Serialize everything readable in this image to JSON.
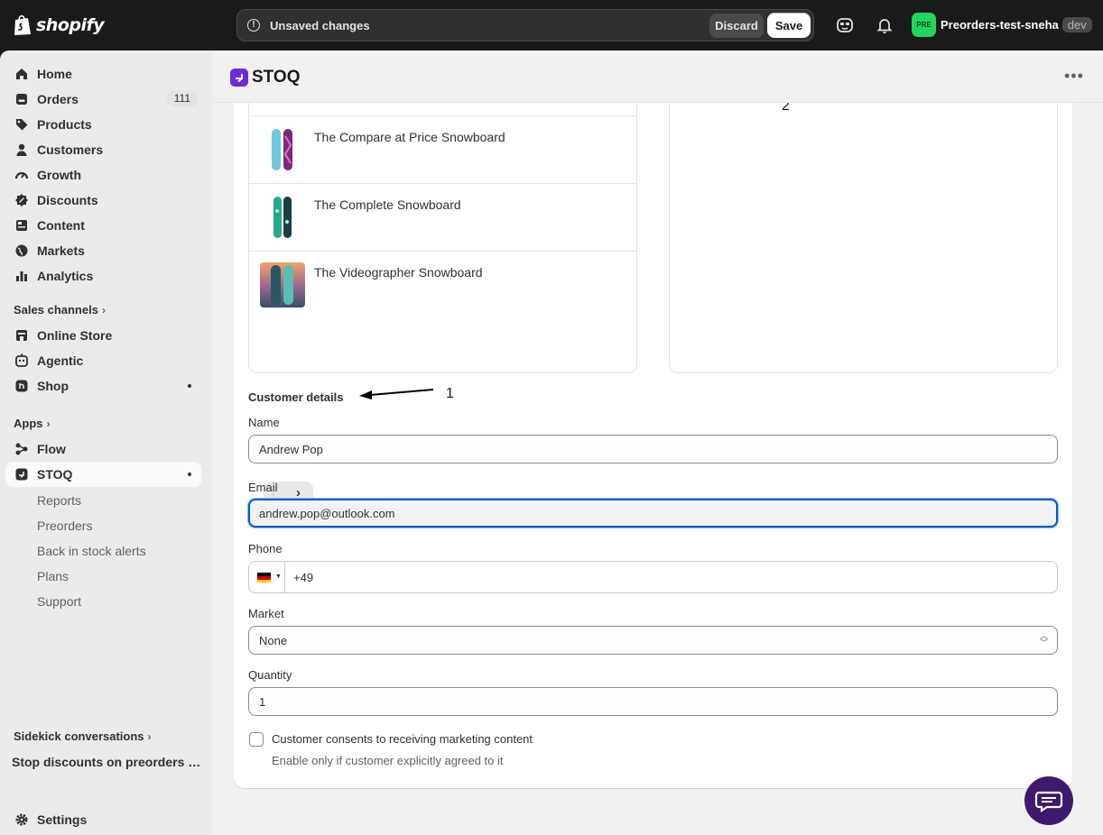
{
  "topbar": {
    "brand": "shopify",
    "unsaved_message": "Unsaved changes",
    "discard_label": "Discard",
    "save_label": "Save",
    "store_avatar": "PRE",
    "store_name": "Preorders-test-sneha",
    "store_badge": "dev"
  },
  "sidebar": {
    "items": [
      {
        "label": "Home",
        "icon": "home-icon"
      },
      {
        "label": "Orders",
        "icon": "orders-icon",
        "count": "111"
      },
      {
        "label": "Products",
        "icon": "tag-icon"
      },
      {
        "label": "Customers",
        "icon": "person-icon"
      },
      {
        "label": "Growth",
        "icon": "gauge-icon"
      },
      {
        "label": "Discounts",
        "icon": "discount-icon"
      },
      {
        "label": "Content",
        "icon": "content-icon"
      },
      {
        "label": "Markets",
        "icon": "globe-icon"
      },
      {
        "label": "Analytics",
        "icon": "bar-chart-icon"
      }
    ],
    "sales_channels_heading": "Sales channels",
    "sales_channels": [
      {
        "label": "Online Store",
        "icon": "store-icon"
      },
      {
        "label": "Agentic",
        "icon": "agent-icon"
      },
      {
        "label": "Shop",
        "icon": "shop-icon"
      }
    ],
    "apps_heading": "Apps",
    "apps": [
      {
        "label": "Flow",
        "icon": "flow-icon"
      },
      {
        "label": "STOQ",
        "icon": "stoq-icon"
      }
    ],
    "stoq_subitems": [
      "Reports",
      "Preorders",
      "Back in stock alerts",
      "Plans",
      "Support"
    ],
    "sidekick_heading": "Sidekick conversations",
    "sidekick_item": "Stop discounts on preorders or...",
    "settings_label": "Settings"
  },
  "app": {
    "title": "STOQ"
  },
  "products": [
    {
      "name": "The Compare at Price Snowboard"
    },
    {
      "name": "The Complete Snowboard"
    },
    {
      "name": "The Videographer Snowboard"
    }
  ],
  "form": {
    "section_title": "Customer details",
    "name_label": "Name",
    "name_value": "Andrew Pop",
    "email_label": "Email",
    "email_value": "andrew.pop@outlook.com",
    "phone_label": "Phone",
    "phone_code": "+49",
    "market_label": "Market",
    "market_value": "None",
    "quantity_label": "Quantity",
    "quantity_value": "1",
    "consent_label": "Customer consents to receiving marketing content",
    "consent_help": "Enable only if customer explicitly agreed to it"
  },
  "annotations": [
    "1",
    "2"
  ],
  "colors": {
    "topbar": "#1a1a1a",
    "focus": "#005bd3",
    "stoq_brand": "#6d2bd9",
    "store_avatar": "#21d55e",
    "chat": "#3d1a6e"
  }
}
